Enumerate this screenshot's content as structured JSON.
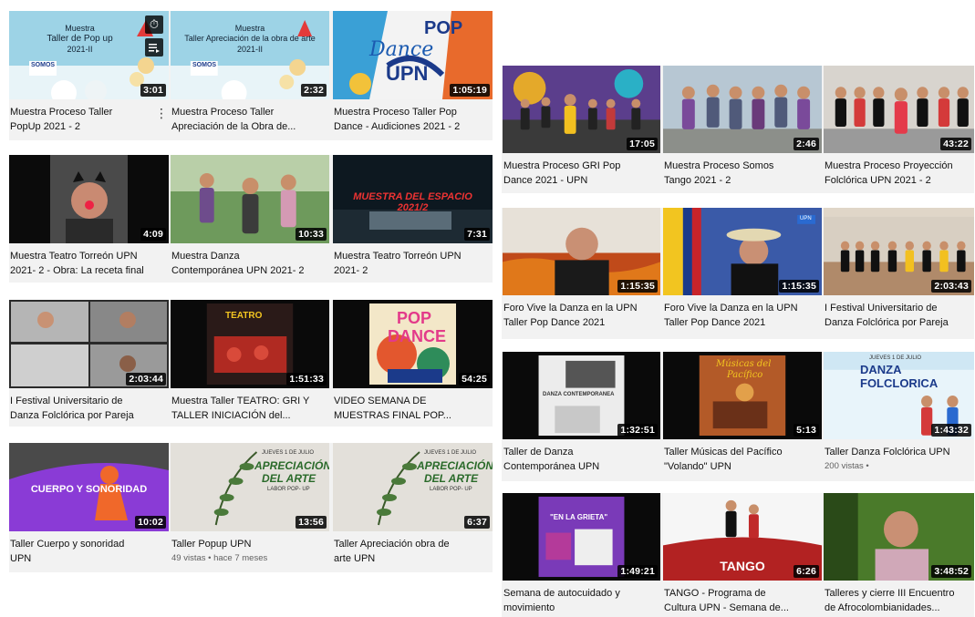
{
  "left_grid": {
    "rows": [
      [
        {
          "title_1": "Muestra Proceso Taller",
          "title_2": "PopUp 2021 - 2",
          "duration": "3:01",
          "thumb_text": "Muestra|Taller de Pop up|2021-II",
          "logo": "SOMOS"
        },
        {
          "title_1": "Muestra Proceso Taller",
          "title_2": "Apreciación de la Obra de...",
          "duration": "2:32",
          "thumb_text": "Muestra|Taller Apreciación de la obra de arte|2021-II",
          "logo": "SOMOS"
        },
        {
          "title_1": "Muestra Proceso Taller Pop",
          "title_2": "Dance - Audiciones 2021 - 2",
          "duration": "1:05:19",
          "thumb_text": "POP|Dance|UPN"
        }
      ],
      [
        {
          "title_1": "Muestra Teatro Torreón UPN",
          "title_2": "2021- 2 - Obra: La receta final",
          "duration": "4:09"
        },
        {
          "title_1": "Muestra Danza",
          "title_2": "Contemporánea UPN 2021- 2",
          "duration": "10:33"
        },
        {
          "title_1": "Muestra Teatro Torreón UPN",
          "title_2": "2021- 2",
          "duration": "7:31",
          "thumb_text": "MUESTRA DEL ESPACIO 2021/2"
        }
      ],
      [
        {
          "title_1": "I Festival Universitario de",
          "title_2": "Danza Folclórica por Pareja",
          "duration": "2:03:44"
        },
        {
          "title_1": "Muestra Taller TEATRO: GRI Y",
          "title_2": "TALLER INICIACIÓN del...",
          "duration": "1:51:33",
          "thumb_text": "TEATRO"
        },
        {
          "title_1": "VIDEO SEMANA DE",
          "title_2": "MUESTRAS FINAL POP...",
          "duration": "54:25",
          "thumb_text": "POP|DANCE"
        }
      ],
      [
        {
          "title_1": "Taller Cuerpo y sonoridad",
          "title_2": "UPN",
          "duration": "10:02",
          "thumb_text": "CUERPO Y SONORIDAD"
        },
        {
          "title_1": "Taller Popup UPN",
          "title_2": "",
          "duration": "13:56",
          "meta": "49 vistas • hace 7 meses",
          "thumb_text": "JUEVES 1 DE JULIO|APRECIACIÓN|DEL ARTE|LABOR POP- UP"
        },
        {
          "title_1": "Taller Apreciación obra de",
          "title_2": "arte UPN",
          "duration": "6:37",
          "thumb_text": "JUEVES 1 DE JULIO|APRECIACIÓN|DEL ARTE|LABOR POP- UP"
        }
      ]
    ]
  },
  "right_grid": {
    "rows": [
      [
        {
          "title_1": "Muestra Proceso GRI Pop",
          "title_2": "Dance 2021 - UPN",
          "duration": "17:05"
        },
        {
          "title_1": "Muestra Proceso Somos",
          "title_2": "Tango 2021 - 2",
          "duration": "2:46"
        },
        {
          "title_1": "Muestra Proceso Proyección",
          "title_2": "Folclórica UPN 2021 - 2",
          "duration": "43:22"
        }
      ],
      [
        {
          "title_1": "Foro Vive la Danza en la UPN",
          "title_2": "Taller Pop Dance 2021",
          "duration": "1:15:35"
        },
        {
          "title_1": "Foro Vive la Danza en la UPN",
          "title_2": "Taller Pop Dance 2021",
          "duration": "1:15:35",
          "thumb_text": "UPN"
        },
        {
          "title_1": "I Festival Universitario de",
          "title_2": "Danza Folclórica por Pareja",
          "duration": "2:03:43"
        }
      ],
      [
        {
          "title_1": "Taller de Danza",
          "title_2": "Contemporánea UPN",
          "duration": "1:32:51",
          "thumb_text": "DANZA CONTEMPORANEA"
        },
        {
          "title_1": "Taller Músicas del Pacífico",
          "title_2": "\"Volando\" UPN",
          "duration": "5:13",
          "thumb_text": "Músicas del|Pacífico"
        },
        {
          "title_1": "Taller Danza Folclórica UPN",
          "title_2": "",
          "duration": "1:43:32",
          "meta": "200 vistas •",
          "thumb_text": "JUEVES 1 DE JULIO|DANZA FOLCLORICA"
        }
      ],
      [
        {
          "title_1": "Semana de autocuidado y",
          "title_2": "movimiento",
          "duration": "1:49:21",
          "thumb_text": "\"EN LA GRIETA\""
        },
        {
          "title_1": "TANGO - Programa de",
          "title_2": "Cultura UPN - Semana de...",
          "duration": "6:26",
          "thumb_text": "TANGO"
        },
        {
          "title_1": "Talleres y cierre III Encuentro",
          "title_2": "de Afrocolombianidades...",
          "duration": "3:48:52"
        }
      ]
    ]
  },
  "colors": {
    "duration_bg": "#000000",
    "row_bg": "#f2f2f2",
    "title_text": "#111111",
    "meta_text": "#606060"
  }
}
